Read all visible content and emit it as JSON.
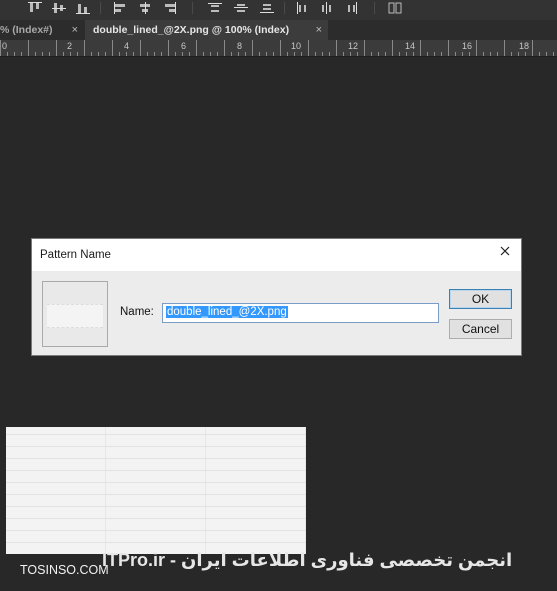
{
  "toolbar": {
    "icons": [
      "align-top-edges-icon",
      "align-vertical-centers-icon",
      "align-bottom-edges-icon",
      "align-left-edges-icon",
      "align-horizontal-centers-icon",
      "align-right-edges-icon",
      "distribute-top-icon",
      "distribute-vertical-centers-icon",
      "distribute-bottom-icon",
      "distribute-left-icon",
      "distribute-horizontal-centers-icon",
      "distribute-right-icon",
      "auto-align-icon"
    ]
  },
  "tabs": [
    {
      "label": "% (Index#)",
      "close": "×"
    },
    {
      "label": "double_lined_@2X.png @ 100% (Index)",
      "close": "×"
    }
  ],
  "ruler": {
    "labels": [
      "0",
      "2",
      "4",
      "6",
      "8",
      "10",
      "12",
      "14",
      "16",
      "18"
    ]
  },
  "dialog": {
    "title": "Pattern Name",
    "name_label": "Name:",
    "name_value": "double_lined_@2X.png",
    "ok_label": "OK",
    "cancel_label": "Cancel"
  },
  "watermarks": {
    "left": "TOSINSO.COM",
    "right": "ITPro.ir - انجمن تخصصی فناوری اطلاعات ایران"
  }
}
